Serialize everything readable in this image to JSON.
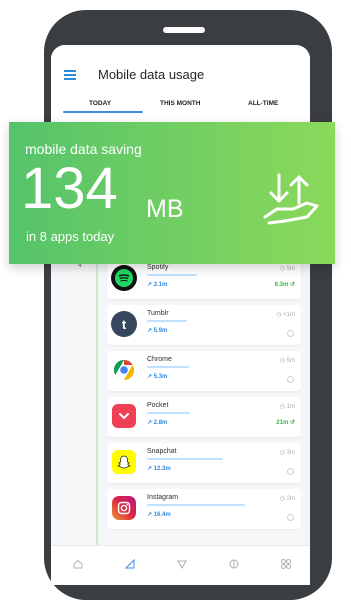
{
  "screen": {
    "title": "Mobile data usage",
    "tabs": [
      "TODAY",
      "THIS MONTH",
      "ALL-TIME"
    ]
  },
  "banner": {
    "label": "mobile data saving",
    "amount": "134",
    "unit": "MB",
    "subtitle": "in 8 apps today"
  },
  "marker": "4",
  "apps": [
    {
      "name": "Spotify",
      "usage": "2.1m",
      "time": "5m",
      "saving": "6.3m",
      "usage_fraction": 0.28,
      "icon": "spotify-icon",
      "color": "#1ed760"
    },
    {
      "name": "Tumblr",
      "usage": "5.9m",
      "time": "<1m",
      "saving": "",
      "usage_fraction": 0.22,
      "icon": "tumblr-icon",
      "color": "#36465d"
    },
    {
      "name": "Chrome",
      "usage": "5.3m",
      "time": "5m",
      "saving": "",
      "usage_fraction": 0.24,
      "icon": "chrome-icon",
      "color": "#db4437"
    },
    {
      "name": "Pocket",
      "usage": "2.8m",
      "time": "1m",
      "saving": "21m",
      "usage_fraction": 0.24,
      "icon": "pocket-icon",
      "color": "#ef4056"
    },
    {
      "name": "Snapchat",
      "usage": "12.3m",
      "time": "3m",
      "saving": "",
      "usage_fraction": 0.56,
      "icon": "snapchat-icon",
      "color": "#fffc00"
    },
    {
      "name": "Instagram",
      "usage": "16.4m",
      "time": "2m",
      "saving": "",
      "usage_fraction": 0.72,
      "icon": "instagram-icon",
      "color": "#c13584"
    }
  ],
  "nav": [
    "home-icon",
    "stats-icon",
    "shield-icon",
    "settings-icon",
    "grid-icon"
  ],
  "colors": {
    "accent": "#2e8bd8",
    "banner": "#6fcf61",
    "save": "#38b449"
  }
}
